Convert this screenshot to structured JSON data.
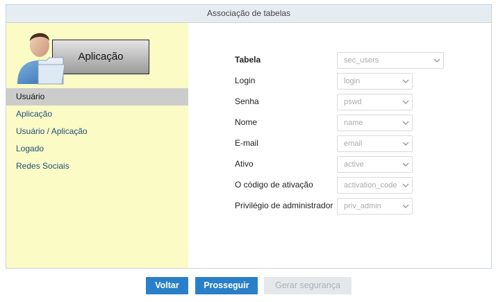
{
  "panel": {
    "title": "Associação de tabelas"
  },
  "sidebar": {
    "illustration_label": "Aplicação",
    "items": [
      {
        "label": "Usuário",
        "active": true
      },
      {
        "label": "Aplicação"
      },
      {
        "label": "Usuário / Aplicação"
      },
      {
        "label": "Logado"
      },
      {
        "label": "Redes Sociais"
      }
    ]
  },
  "form": {
    "rows": [
      {
        "label": "Tabela",
        "value": "sec_users"
      },
      {
        "label": "Login",
        "value": "login"
      },
      {
        "label": "Senha",
        "value": "pswd"
      },
      {
        "label": "Nome",
        "value": "name"
      },
      {
        "label": "E-mail",
        "value": "email"
      },
      {
        "label": "Ativo",
        "value": "active"
      },
      {
        "label": "O código de ativação",
        "value": "activation_code"
      },
      {
        "label": "Privilégio de administrador",
        "value": "priv_admin"
      }
    ]
  },
  "buttons": {
    "back": "Voltar",
    "next": "Prosseguir",
    "generate": "Gerar segurança"
  },
  "icons": {
    "person": "person-icon",
    "folder": "folder-icon",
    "chevron": "chevron-down-icon"
  },
  "colors": {
    "sidebar_bg": "#fbfbc6",
    "primary_button": "#2a80c8",
    "header_bg": "#e6edf2"
  }
}
